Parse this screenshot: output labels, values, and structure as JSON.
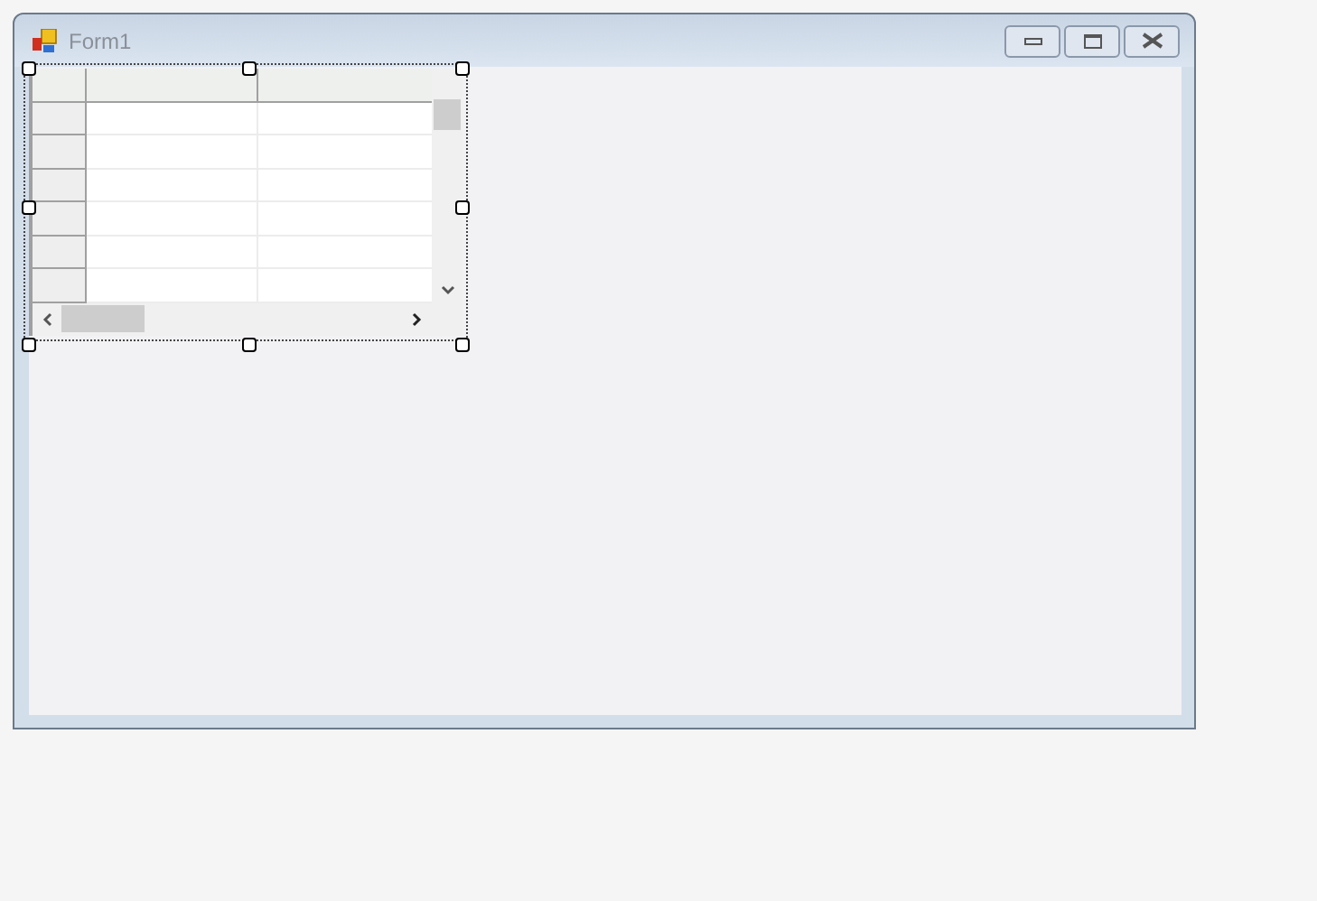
{
  "window": {
    "title": "Form1"
  },
  "grid": {
    "selected": true
  }
}
